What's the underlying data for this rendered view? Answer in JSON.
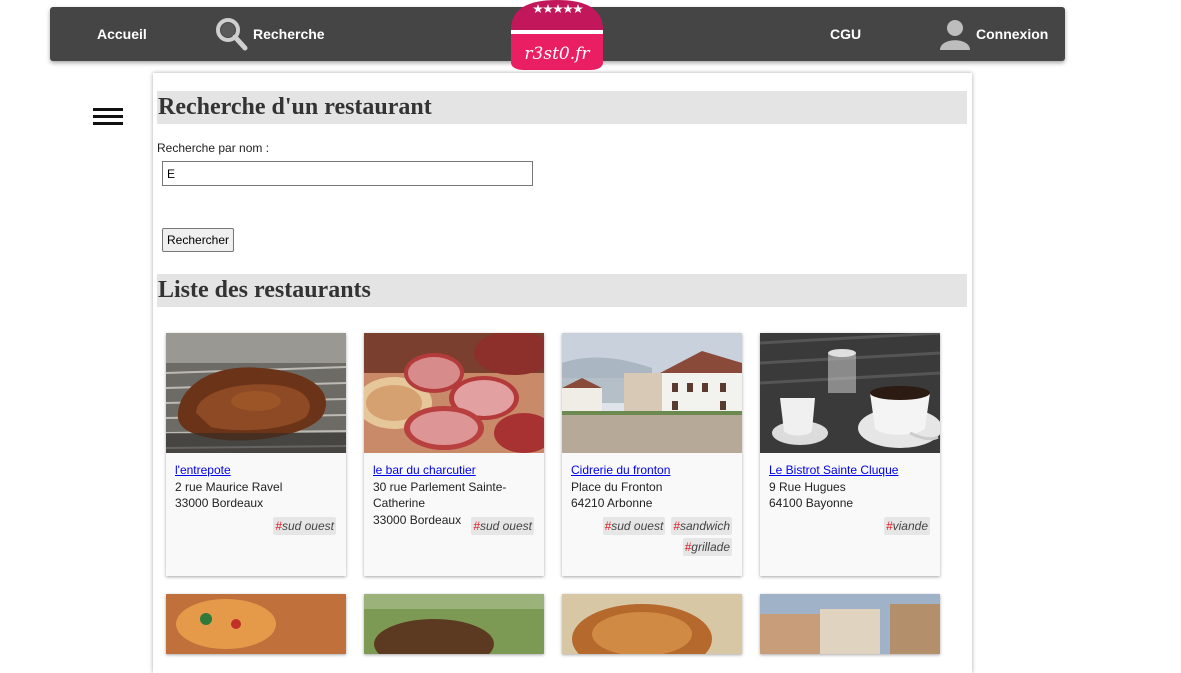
{
  "nav": {
    "home_label": "Accueil",
    "search_label": "Recherche",
    "cgu_label": "CGU",
    "login_label": "Connexion",
    "logo_text": "r3st0.fr",
    "search_icon": "magnifier-icon",
    "login_icon": "user-icon"
  },
  "search": {
    "title": "Recherche d'un restaurant",
    "label": "Recherche par nom :",
    "value": "E",
    "button_label": "Rechercher"
  },
  "list": {
    "title": "Liste des restaurants",
    "restaurants": [
      {
        "name": "l'entrepote",
        "street": "2 rue Maurice Ravel",
        "city": "33000 Bordeaux",
        "tags": [
          "sud ouest"
        ],
        "image": "grilled-meat-photo"
      },
      {
        "name": "le bar du charcutier",
        "street": "30 rue Parlement Sainte-Catherine",
        "city": "33000 Bordeaux",
        "tags": [
          "sud ouest"
        ],
        "image": "charcuterie-photo"
      },
      {
        "name": "Cidrerie du fronton",
        "street": "Place du Fronton",
        "city": "64210 Arbonne",
        "tags": [
          "sud ouest",
          "sandwich",
          "grillade"
        ],
        "image": "fronton-photo"
      },
      {
        "name": "Le Bistrot Sainte Cluque",
        "street": "9 Rue Hugues",
        "city": "64100 Bayonne",
        "tags": [
          "viande"
        ],
        "image": "coffee-cups-photo"
      }
    ],
    "tag_prefix": "#"
  },
  "colors": {
    "nav_bg": "#454545",
    "section_bg": "#e4e4e4",
    "tag_hash": "#e0151f",
    "logo_top": "#c2185b",
    "logo_bottom": "#e91e63",
    "link": "#0000ee"
  }
}
